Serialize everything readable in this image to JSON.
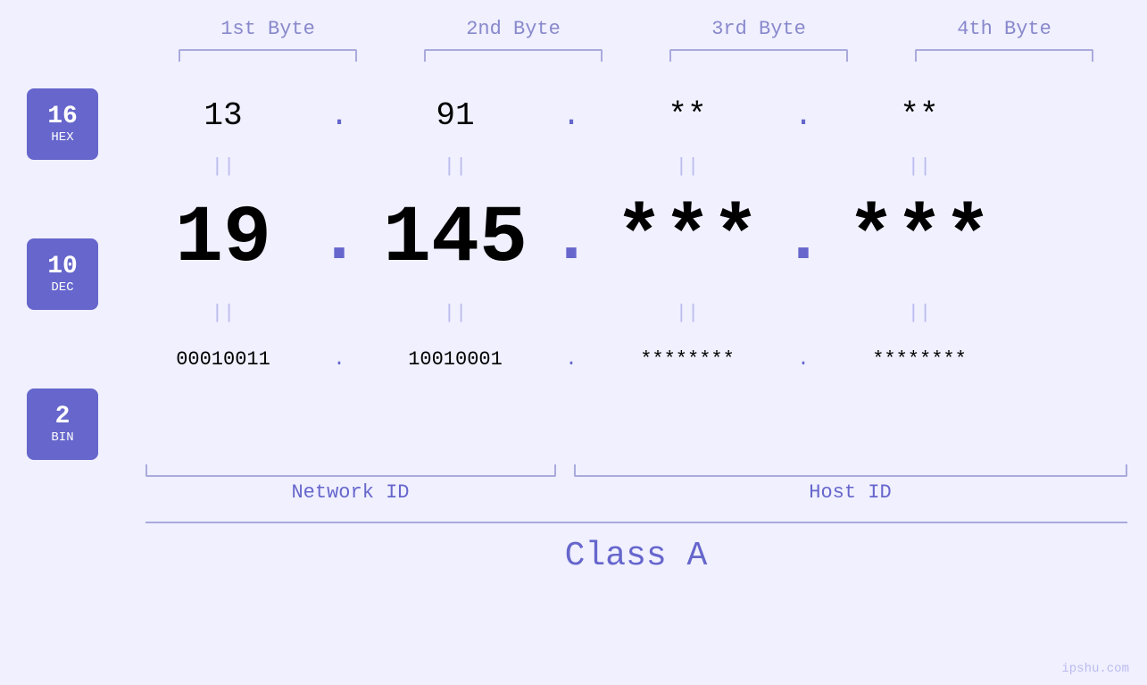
{
  "headers": {
    "byte1": "1st Byte",
    "byte2": "2nd Byte",
    "byte3": "3rd Byte",
    "byte4": "4th Byte"
  },
  "badges": {
    "hex": {
      "num": "16",
      "label": "HEX"
    },
    "dec": {
      "num": "10",
      "label": "DEC"
    },
    "bin": {
      "num": "2",
      "label": "BIN"
    }
  },
  "hex_row": {
    "b1": "13",
    "b2": "91",
    "b3": "**",
    "b4": "**",
    "dot": "."
  },
  "dec_row": {
    "b1": "19",
    "b2": "145",
    "b3": "***",
    "b4": "***",
    "dot": "."
  },
  "bin_row": {
    "b1": "00010011",
    "b2": "10010001",
    "b3": "********",
    "b4": "********",
    "dot": "."
  },
  "labels": {
    "network_id": "Network ID",
    "host_id": "Host ID",
    "class": "Class A"
  },
  "watermark": "ipshu.com"
}
